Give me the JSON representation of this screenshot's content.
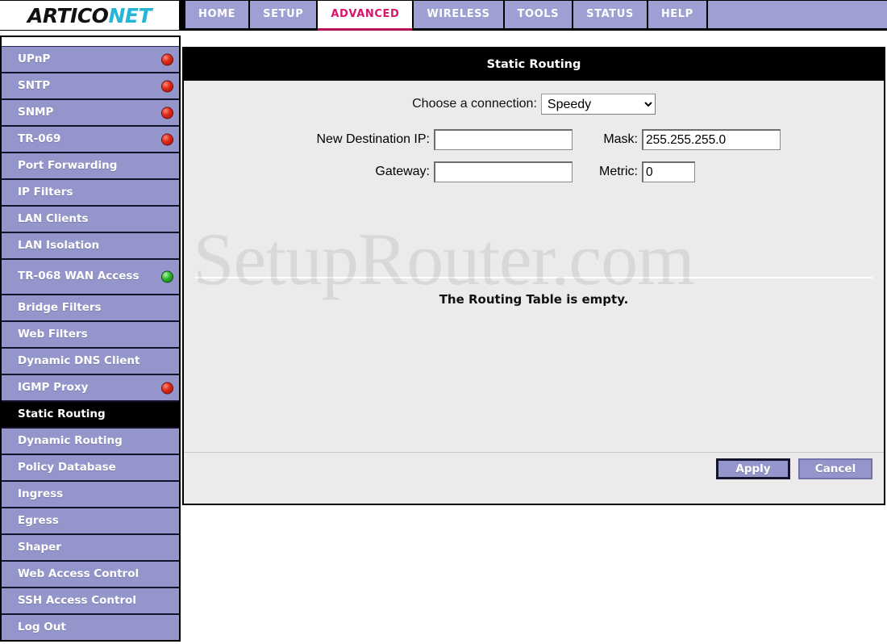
{
  "brand": {
    "name_part1": "ARTICO",
    "name_part2": "NET"
  },
  "nav": {
    "items": [
      {
        "label": "HOME",
        "active": false
      },
      {
        "label": "SETUP",
        "active": false
      },
      {
        "label": "ADVANCED",
        "active": true
      },
      {
        "label": "WIRELESS",
        "active": false
      },
      {
        "label": "TOOLS",
        "active": false
      },
      {
        "label": "STATUS",
        "active": false
      },
      {
        "label": "HELP",
        "active": false
      }
    ]
  },
  "sidebar": {
    "items": [
      {
        "label": "UPnP",
        "led": "red",
        "active": false
      },
      {
        "label": "SNTP",
        "led": "red",
        "active": false
      },
      {
        "label": "SNMP",
        "led": "red",
        "active": false
      },
      {
        "label": "TR-069",
        "led": "red",
        "active": false
      },
      {
        "label": "Port Forwarding",
        "led": "none",
        "active": false
      },
      {
        "label": "IP Filters",
        "led": "none",
        "active": false
      },
      {
        "label": "LAN Clients",
        "led": "none",
        "active": false
      },
      {
        "label": "LAN Isolation",
        "led": "none",
        "active": false
      },
      {
        "label": "TR-068 WAN Access",
        "led": "green",
        "active": false,
        "two_line": true
      },
      {
        "label": "Bridge Filters",
        "led": "none",
        "active": false
      },
      {
        "label": "Web Filters",
        "led": "none",
        "active": false
      },
      {
        "label": "Dynamic DNS Client",
        "led": "none",
        "active": false
      },
      {
        "label": "IGMP Proxy",
        "led": "red",
        "active": false
      },
      {
        "label": "Static Routing",
        "led": "none",
        "active": true
      },
      {
        "label": "Dynamic Routing",
        "led": "none",
        "active": false
      },
      {
        "label": "Policy Database",
        "led": "none",
        "active": false
      },
      {
        "label": "Ingress",
        "led": "none",
        "active": false
      },
      {
        "label": "Egress",
        "led": "none",
        "active": false
      },
      {
        "label": "Shaper",
        "led": "none",
        "active": false
      },
      {
        "label": "Web Access Control",
        "led": "none",
        "active": false
      },
      {
        "label": "SSH Access Control",
        "led": "none",
        "active": false
      },
      {
        "label": "Log Out",
        "led": "none",
        "active": false
      }
    ]
  },
  "panel": {
    "title": "Static Routing",
    "connection_label": "Choose a connection:",
    "connection_value": "Speedy",
    "connection_options": [
      "Speedy"
    ],
    "dest_ip_label": "New Destination IP:",
    "dest_ip_value": "",
    "mask_label": "Mask:",
    "mask_value": "255.255.255.0",
    "gateway_label": "Gateway:",
    "gateway_value": "",
    "metric_label": "Metric:",
    "metric_value": "0",
    "empty_message": "The Routing Table is empty.",
    "apply_label": "Apply",
    "cancel_label": "Cancel"
  },
  "watermark": {
    "text": "SetupRouter.com"
  },
  "colors": {
    "sidebar_bg": "#9495cb",
    "nav_bg": "#9e9fd2",
    "active_nav_text": "#d6156b",
    "panel_bg": "#eceaea",
    "led_red": "#e02a18",
    "led_green": "#2db52b"
  }
}
